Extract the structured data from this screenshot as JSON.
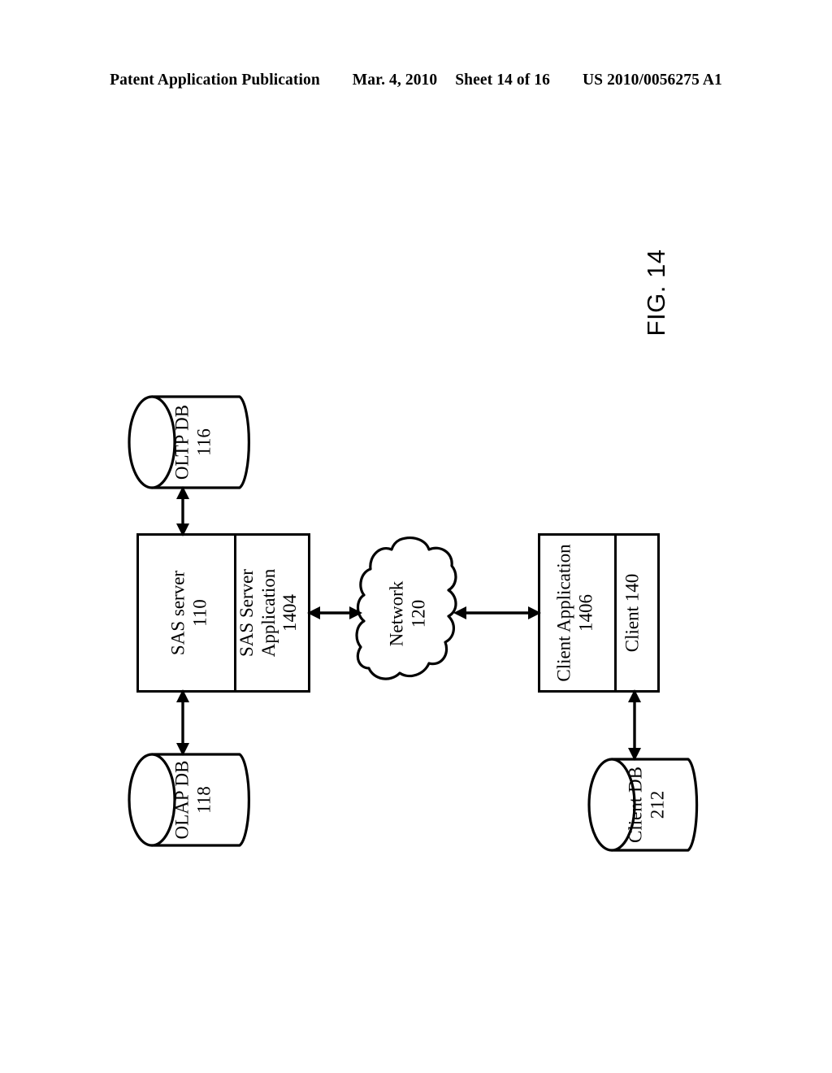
{
  "header": {
    "publication": "Patent Application Publication",
    "date": "Mar. 4, 2010",
    "sheet": "Sheet 14 of 16",
    "pub_number": "US 2010/0056275 A1"
  },
  "figure": {
    "label": "FIG. 14"
  },
  "diagram": {
    "type": "block-diagram",
    "orientation": "rotated-90-counterclockwise",
    "nodes": [
      {
        "id": "oltp-db",
        "shape": "cylinder",
        "name": "OLTP DB",
        "ref": "116",
        "lines": [
          "OLTP DB",
          "116"
        ]
      },
      {
        "id": "olap-db",
        "shape": "cylinder",
        "name": "OLAP DB",
        "ref": "118",
        "lines": [
          "OLAP DB",
          "118"
        ]
      },
      {
        "id": "sas-server",
        "shape": "box",
        "name": "SAS server",
        "ref": "110",
        "lines": [
          "SAS server",
          "110"
        ]
      },
      {
        "id": "sas-server-application",
        "shape": "box-compartment",
        "name": "SAS Server Application",
        "ref": "1404",
        "lines": [
          "SAS Server",
          "Application",
          "1404"
        ]
      },
      {
        "id": "network",
        "shape": "cloud",
        "name": "Network",
        "ref": "120",
        "lines": [
          "Network",
          "120"
        ]
      },
      {
        "id": "client-application",
        "shape": "box-compartment",
        "name": "Client Application",
        "ref": "1406",
        "lines": [
          "Client Application",
          "1406"
        ]
      },
      {
        "id": "client",
        "shape": "box",
        "name": "Client",
        "ref": "140",
        "lines": [
          "Client 140"
        ]
      },
      {
        "id": "client-db",
        "shape": "cylinder",
        "name": "Client DB",
        "ref": "212",
        "lines": [
          "Client DB",
          "212"
        ]
      }
    ],
    "connections": [
      {
        "id": "sas-oltp",
        "from": "sas-server",
        "to": "oltp-db",
        "style": "double-arrow"
      },
      {
        "id": "sas-olap",
        "from": "sas-server",
        "to": "olap-db",
        "style": "double-arrow"
      },
      {
        "id": "sas-network",
        "from": "sas-server-application",
        "to": "network",
        "style": "double-arrow"
      },
      {
        "id": "network-client",
        "from": "network",
        "to": "client-application",
        "style": "double-arrow"
      },
      {
        "id": "client-clientdb",
        "from": "client",
        "to": "client-db",
        "style": "double-arrow"
      }
    ]
  },
  "colors": {
    "ink": "#000000",
    "paper": "#ffffff"
  }
}
